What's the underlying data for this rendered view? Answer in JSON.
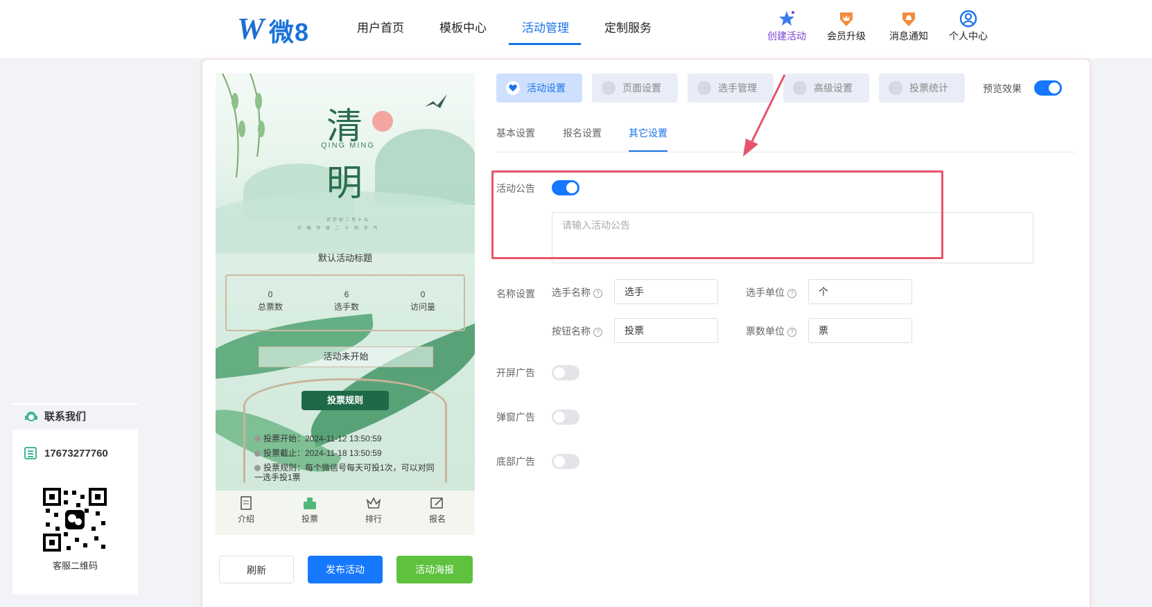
{
  "header": {
    "logo_mark": "W",
    "logo_text": "微8",
    "nav": [
      "用户首页",
      "模板中心",
      "活动管理",
      "定制服务"
    ],
    "active_nav": "活动管理",
    "actions": [
      {
        "label": "创建活动",
        "icon": "star-cluster-icon",
        "color": "#7b3fd1"
      },
      {
        "label": "会员升级",
        "icon": "crown-badge-icon",
        "color": "#f28b3c"
      },
      {
        "label": "消息通知",
        "icon": "bell-badge-icon",
        "color": "#f28b3c"
      },
      {
        "label": "个人中心",
        "icon": "user-circle-icon",
        "color": "#1a73e8"
      }
    ]
  },
  "preview": {
    "banner_char_1": "清",
    "banner_char_2": "明",
    "banner_en": "QING MING",
    "banner_small_1": "农历初二月十五",
    "banner_small_2": "中 国 传 统 二 十 四 节 气",
    "title": "默认活动标题",
    "stats": [
      {
        "value": "0",
        "label": "总票数"
      },
      {
        "value": "6",
        "label": "选手数"
      },
      {
        "value": "0",
        "label": "访问量"
      }
    ],
    "status": "活动未开始",
    "rules_button": "投票规则",
    "rules": [
      "投票开始：2024-11-12 13:50:59",
      "投票截止：2024-11-18 13:50:59",
      "投票规则：每个微信号每天可投1次，可以对同一选手投1票"
    ],
    "bottom_tabs": [
      "介绍",
      "投票",
      "排行",
      "报名"
    ]
  },
  "buttons": {
    "refresh": "刷新",
    "publish": "发布活动",
    "poster": "活动海报"
  },
  "top_tabs": [
    "活动设置",
    "页面设置",
    "选手管理",
    "高级设置",
    "投票统计"
  ],
  "active_top_tab": "活动设置",
  "preview_toggle": {
    "label": "预览效果",
    "on": true
  },
  "sub_tabs": [
    "基本设置",
    "报名设置",
    "其它设置"
  ],
  "active_sub_tab": "其它设置",
  "form": {
    "announcement": {
      "label": "活动公告",
      "on": true,
      "placeholder": "请输入活动公告"
    },
    "name_settings": {
      "label": "名称设置",
      "player_name_label": "选手名称",
      "player_name_value": "选手",
      "player_unit_label": "选手单位",
      "player_unit_value": "个",
      "button_name_label": "按钮名称",
      "button_name_value": "投票",
      "vote_unit_label": "票数单位",
      "vote_unit_value": "票"
    },
    "splash_ad": {
      "label": "开屏广告",
      "on": false
    },
    "popup_ad": {
      "label": "弹窗广告",
      "on": false
    },
    "bottom_ad": {
      "label": "底部广告",
      "on": false
    }
  },
  "contact": {
    "title": "联系我们",
    "phone": "17673277760",
    "qr_label": "客服二维码"
  },
  "colors": {
    "primary": "#1677ff",
    "poster_green": "#5ec23f",
    "highlight_red": "#e5546a"
  }
}
